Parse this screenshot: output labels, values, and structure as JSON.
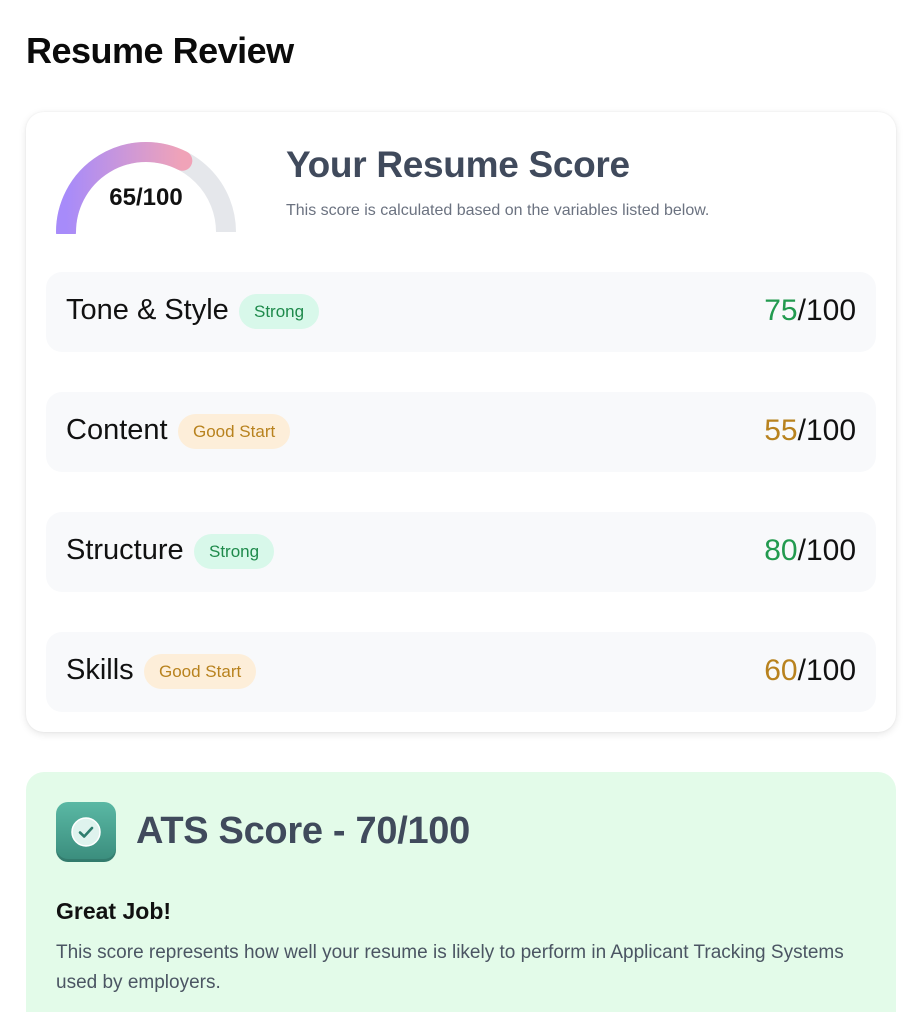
{
  "page": {
    "title": "Resume Review"
  },
  "resume_score": {
    "gauge_label": "65/100",
    "score": 65,
    "max": 100,
    "heading": "Your Resume Score",
    "subtitle": "This score is calculated based on the variables listed below.",
    "categories": [
      {
        "name": "Tone & Style",
        "badge": "Strong",
        "badge_type": "strong",
        "score": "75",
        "max": "/100"
      },
      {
        "name": "Content",
        "badge": "Good Start",
        "badge_type": "good",
        "score": "55",
        "max": "/100"
      },
      {
        "name": "Structure",
        "badge": "Strong",
        "badge_type": "strong",
        "score": "80",
        "max": "/100"
      },
      {
        "name": "Skills",
        "badge": "Good Start",
        "badge_type": "good",
        "score": "60",
        "max": "/100"
      }
    ]
  },
  "ats": {
    "icon": "check-badge-icon",
    "title": "ATS Score - 70/100",
    "heading": "Great Job!",
    "description": "This score represents how well your resume is likely to perform in Applicant Tracking Systems used by employers."
  },
  "colors": {
    "strong_text": "#229a4f",
    "strong_bg": "#d8f8ea",
    "good_text": "#b8821e",
    "good_bg": "#fdeed9",
    "gauge_start": "#a78bfa",
    "gauge_end": "#f0a3b8",
    "ats_bg": "#e3fbe9"
  }
}
